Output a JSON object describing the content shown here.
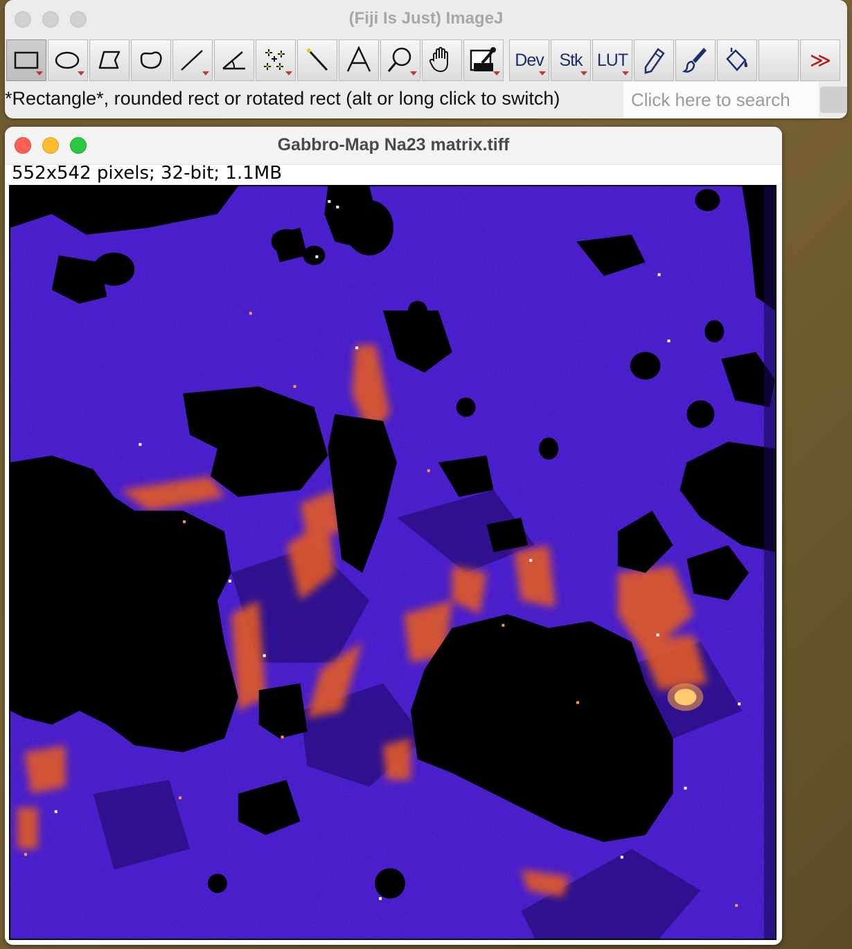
{
  "toolbar_window": {
    "title": "(Fiji Is Just) ImageJ",
    "tools": [
      {
        "name": "rectangle-tool",
        "icon": "rectangle-icon",
        "selected": true,
        "has_menu": true
      },
      {
        "name": "oval-tool",
        "icon": "oval-icon",
        "has_menu": true
      },
      {
        "name": "polygon-tool",
        "icon": "polygon-icon"
      },
      {
        "name": "freehand-tool",
        "icon": "freehand-icon"
      },
      {
        "name": "line-tool",
        "icon": "line-icon",
        "has_menu": true
      },
      {
        "name": "angle-tool",
        "icon": "angle-icon"
      },
      {
        "name": "point-tool",
        "icon": "multipoint-icon",
        "has_menu": true
      },
      {
        "name": "wand-tool",
        "icon": "wand-icon"
      },
      {
        "name": "text-tool",
        "icon": "text-icon"
      },
      {
        "name": "zoom-tool",
        "icon": "magnifier-icon",
        "has_menu": true
      },
      {
        "name": "hand-tool",
        "icon": "hand-icon"
      },
      {
        "name": "color-picker-tool",
        "icon": "dropper-icon",
        "has_menu": true
      }
    ],
    "menu_tools": {
      "dev": "Dev",
      "stk": "Stk",
      "lut": "LUT"
    },
    "status": "*Rectangle*, rounded rect or rotated rect (alt or long click to switch)",
    "search_placeholder": "Click here to search",
    "more_label": "≫"
  },
  "image_window": {
    "title": "Gabbro-Map Na23 matrix.tiff",
    "info": "552x542 pixels; 32-bit; 1.1MB",
    "lut": "fire"
  },
  "colors": {
    "matrix": "#3b10c8",
    "hot": "#e9632a",
    "black": "#000000"
  }
}
